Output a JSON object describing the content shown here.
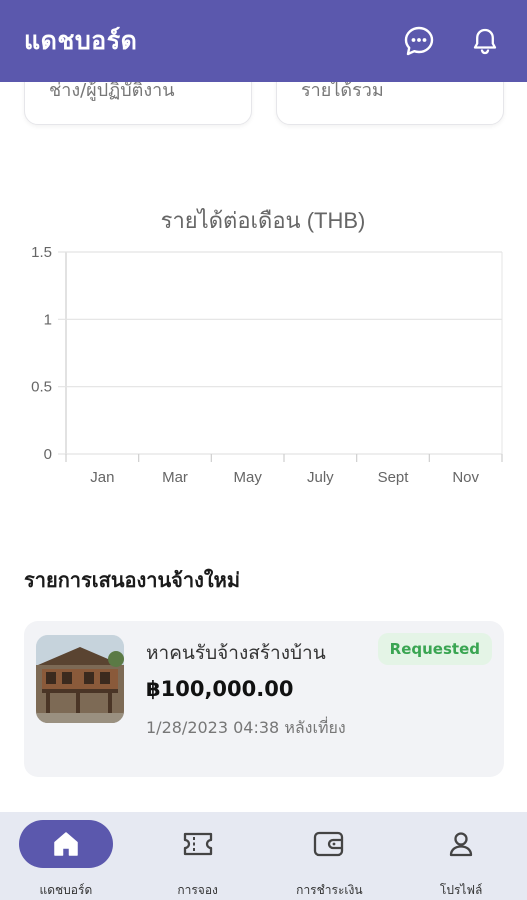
{
  "appbar": {
    "title": "แดชบอร์ด",
    "icons": [
      "chat-icon",
      "bell-icon"
    ],
    "color": "#5b58ad"
  },
  "stats": {
    "card1_label": "ช่าง/ผู้ปฏิบัติงาน",
    "card2_label": "รายได้รวม"
  },
  "chart_data": {
    "type": "line",
    "title": "รายได้ต่อเดือน (THB)",
    "categories": [
      "Jan",
      "Mar",
      "May",
      "July",
      "Sept",
      "Nov"
    ],
    "yticks": [
      "0",
      "0.5",
      "1",
      "1.5"
    ],
    "ylim": [
      0,
      1.5
    ],
    "series": [],
    "grid": true
  },
  "section": {
    "title": "รายการเสนองานจ้างใหม่"
  },
  "job": {
    "title": "หาคนรับจ้างสร้างบ้าน",
    "status": "Requested",
    "price": "฿100,000.00",
    "date": "1/28/2023 04:38 หลังเที่ยง",
    "status_color": "#3aa552"
  },
  "nav": {
    "items": [
      {
        "label": "แดชบอร์ด",
        "icon": "home-icon",
        "active": true
      },
      {
        "label": "การจอง",
        "icon": "ticket-icon",
        "active": false
      },
      {
        "label": "การชำระเงิน",
        "icon": "wallet-icon",
        "active": false
      },
      {
        "label": "โปรไฟล์",
        "icon": "profile-icon",
        "active": false
      }
    ]
  }
}
